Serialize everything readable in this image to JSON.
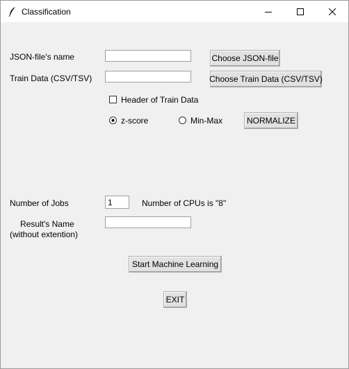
{
  "window": {
    "title": "Classification"
  },
  "form": {
    "json_label": "JSON-file's name",
    "json_value": "",
    "json_button": "Choose JSON-file",
    "train_label": "Train Data (CSV/TSV)",
    "train_value": "",
    "train_button": "Choose Train Data (CSV/TSV)",
    "header_checkbox_label": "Header of Train Data",
    "header_checked": false,
    "radio_zscore_label": "z-score",
    "radio_minmax_label": "Min-Max",
    "selected_normalization": "z-score",
    "normalize_button": "NORMALIZE",
    "jobs_label": "Number of Jobs",
    "jobs_value": "1",
    "cpus_text": "Number of CPUs is \"8\"",
    "result_label_line1": "Result's Name",
    "result_label_line2": "(without extention)",
    "result_value": "",
    "start_button": "Start Machine Learning",
    "exit_button": "EXIT"
  }
}
